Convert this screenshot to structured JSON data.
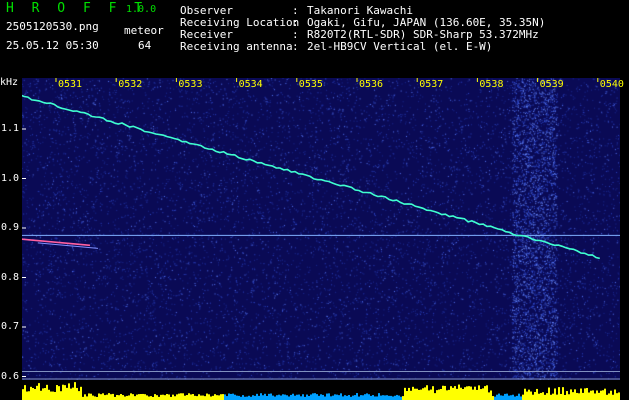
{
  "header": {
    "app_title": "H R O F F T",
    "app_version": "1.0.0",
    "file_name": "2505120530.png",
    "date_time": "25.05.12 05:30",
    "meteor_label": "meteor",
    "meteor_count": "64"
  },
  "info": [
    {
      "label": "Observer",
      "value": "Takanori Kawachi"
    },
    {
      "label": "Receiving Location",
      "value": "Ogaki, Gifu, JAPAN (136.60E, 35.35N)"
    },
    {
      "label": "Receiver",
      "value": "R820T2(RTL-SDR) SDR-Sharp 53.372MHz"
    },
    {
      "label": "Receiving antenna",
      "value": "2el-HB9CV Vertical (el. E-W)"
    }
  ],
  "info_colon": ":",
  "chart_data": {
    "type": "spectrogram",
    "xlabel": "",
    "ylabel": "kHz",
    "x_ticks": [
      "0531",
      "0532",
      "0533",
      "0534",
      "0535",
      "0536",
      "0537",
      "0538",
      "0539",
      "0540"
    ],
    "y_ticks": [
      "1.1",
      "1.0",
      "0.9",
      "0.8",
      "0.7",
      "0.6"
    ],
    "y_range": [
      0.6,
      1.2
    ],
    "carrier_line": {
      "start_time": "0530",
      "start_khz": 1.18,
      "end_time": "0540",
      "end_khz": 0.84
    },
    "reference_line_khz": 0.885,
    "meteor_echo": {
      "start_time": "0530",
      "end_time": "0531",
      "start_khz": 0.88,
      "end_khz": 0.865
    },
    "colors": {
      "background": "#0a0a55",
      "noise": "#3050ff",
      "carrier": "#40ffd0",
      "reference": "#80b0ff",
      "echo": "#ff60a0",
      "level": "#ffff00",
      "level_blue": "#00a0ff",
      "tick_labels": "#ffff00"
    }
  }
}
